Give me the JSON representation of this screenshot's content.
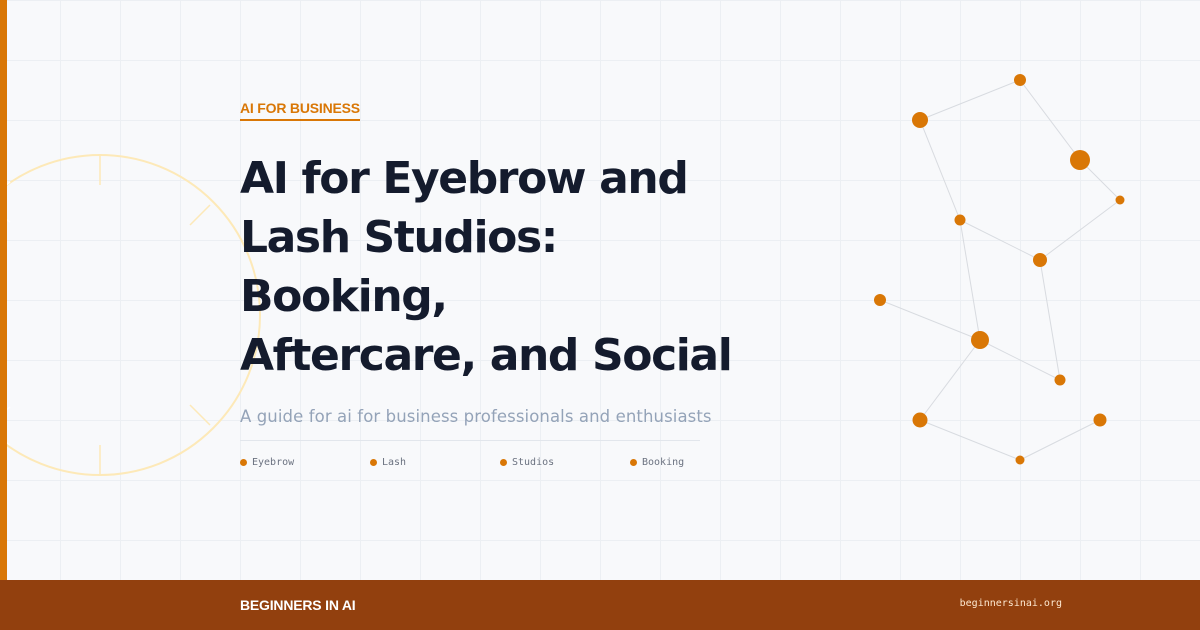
{
  "header": {
    "category": "AI FOR BUSINESS",
    "title_lines": [
      "AI for Eyebrow and",
      "Lash Studios: Booking,",
      "Aftercare, and Social"
    ],
    "subtitle": "A guide for ai for business professionals and enthusiasts"
  },
  "tags": [
    {
      "label": "Eyebrow"
    },
    {
      "label": "Lash"
    },
    {
      "label": "Studios"
    },
    {
      "label": "Booking"
    }
  ],
  "footer": {
    "brand": "BEGINNERS IN AI",
    "site": "beginnersinai.org"
  },
  "colors": {
    "accent": "#d97706",
    "footer_bg": "#92400e",
    "title": "#141b2d",
    "subtitle": "#94a3b8",
    "background": "#f8f9fb"
  },
  "decorations": {
    "left_shape": "target-circle",
    "right_shape": "node-network"
  }
}
